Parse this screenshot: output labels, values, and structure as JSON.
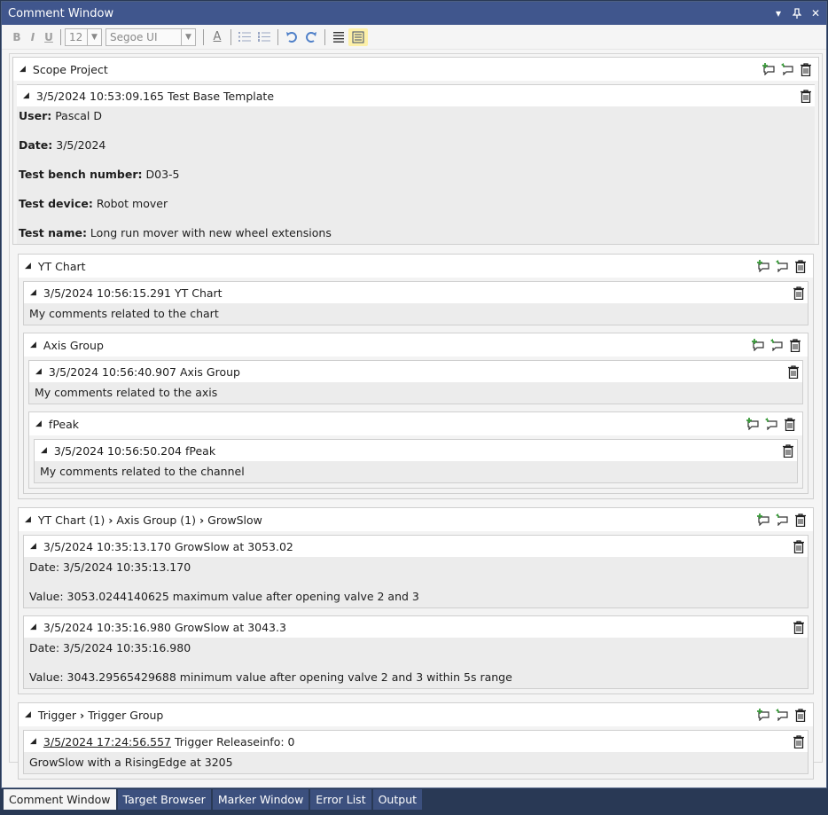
{
  "window": {
    "title": "Comment Window"
  },
  "toolbar": {
    "bold": "B",
    "italic": "I",
    "underline": "U",
    "font_size": "12",
    "font_family": "Segoe UI",
    "font_color": "A"
  },
  "groups": [
    {
      "title": "Scope Project",
      "comments": [
        {
          "header": "3/5/2024 10:53:09.165 Test Base Template",
          "fields": [
            {
              "key": "User:",
              "value": " Pascal D"
            },
            {
              "key": "Date:",
              "value": " 3/5/2024"
            },
            {
              "key": "Test bench number:",
              "value": " D03-5"
            },
            {
              "key": "Test device:",
              "value": " Robot mover"
            },
            {
              "key": "Test name:",
              "value": " Long run mover with new wheel extensions"
            }
          ]
        }
      ]
    },
    {
      "title": "YT Chart",
      "comments": [
        {
          "header": "3/5/2024 10:56:15.291 YT Chart",
          "text": "My comments related to the chart"
        }
      ],
      "subgroups": [
        {
          "title": "Axis Group",
          "comments": [
            {
              "header": "3/5/2024 10:56:40.907 Axis Group",
              "text": "My comments related to the axis"
            }
          ],
          "subgroups": [
            {
              "title": "fPeak",
              "comments": [
                {
                  "header": "3/5/2024 10:56:50.204 fPeak",
                  "text": "My comments related to the channel"
                }
              ]
            }
          ]
        }
      ]
    },
    {
      "crumbs": [
        "YT Chart (1)",
        "Axis Group (1)",
        "GrowSlow"
      ],
      "comments": [
        {
          "header": "3/5/2024 10:35:13.170 GrowSlow at 3053.02",
          "line1": "Date: 3/5/2024 10:35:13.170",
          "line2": "Value: 3053.0244140625 maximum value after opening valve 2 and 3"
        },
        {
          "header": "3/5/2024 10:35:16.980 GrowSlow at 3043.3",
          "line1": "Date: 3/5/2024 10:35:16.980",
          "line2": "Value: 3043.29565429688 minimum value after opening valve 2 and 3 within 5s range"
        }
      ]
    },
    {
      "crumbs": [
        "Trigger",
        "Trigger Group"
      ],
      "comments": [
        {
          "timestamp": "3/5/2024 17:24:56.557",
          "header_rest": " Trigger Releaseinfo: 0",
          "text": "GrowSlow with a RisingEdge at 3205"
        }
      ]
    }
  ],
  "tabs": [
    "Comment Window",
    "Target Browser",
    "Marker Window",
    "Error List",
    "Output"
  ],
  "colors": {
    "titlebar": "#40568d",
    "background": "#293955",
    "add_icon": "#3a9a3a",
    "highlight": "#fdf0a8"
  }
}
